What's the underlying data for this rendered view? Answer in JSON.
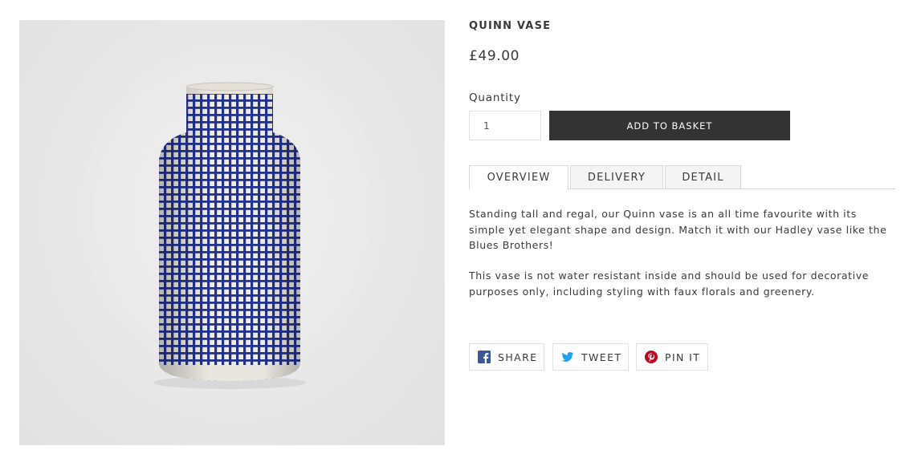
{
  "product": {
    "title": "QUINN VASE",
    "price": "£49.00",
    "image_alt": "Blue and white checked ceramic vase"
  },
  "form": {
    "quantity_label": "Quantity",
    "quantity_value": "1",
    "add_to_basket_label": "ADD TO BASKET"
  },
  "tabs": [
    {
      "label": "OVERVIEW",
      "active": true
    },
    {
      "label": "DELIVERY",
      "active": false
    },
    {
      "label": "DETAIL",
      "active": false
    }
  ],
  "overview": {
    "paragraph_1": "Standing tall and regal, our Quinn vase is an all time favourite with its simple yet elegant shape and design. Match it with our Hadley vase like the Blues Brothers!",
    "paragraph_2": "This vase is not water resistant inside and should be used for decorative purposes only, including styling with faux florals and greenery."
  },
  "share": [
    {
      "label": "SHARE",
      "icon": "facebook-icon",
      "color": "#3b5998"
    },
    {
      "label": "TWEET",
      "icon": "twitter-icon",
      "color": "#1da1f2"
    },
    {
      "label": "PIN IT",
      "icon": "pinterest-icon",
      "color": "#bd081c"
    }
  ],
  "colors": {
    "button_bg": "#333333",
    "vase_blue": "#1f2f8a",
    "vase_body": "#f0ede6"
  }
}
